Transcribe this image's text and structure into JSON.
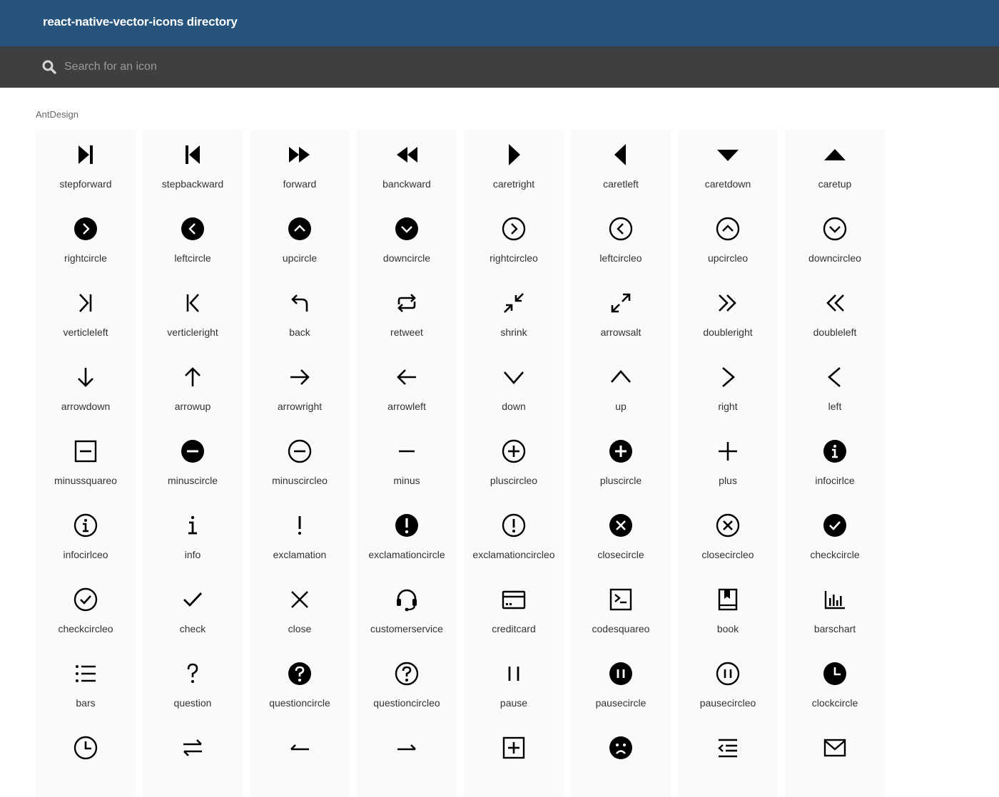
{
  "app": {
    "title": "react-native-vector-icons directory"
  },
  "search": {
    "placeholder": "Search for an icon",
    "value": ""
  },
  "colors": {
    "header": "#26547c",
    "search_bar": "#3f3f3f",
    "tile": "#fafafa"
  },
  "section": {
    "label": "AntDesign",
    "icons": [
      {
        "label": "stepforward",
        "icon": "stepforward"
      },
      {
        "label": "stepbackward",
        "icon": "stepbackward"
      },
      {
        "label": "forward",
        "icon": "forward"
      },
      {
        "label": "banckward",
        "icon": "backward"
      },
      {
        "label": "caretright",
        "icon": "caretright"
      },
      {
        "label": "caretleft",
        "icon": "caretleft"
      },
      {
        "label": "caretdown",
        "icon": "caretdown"
      },
      {
        "label": "caretup",
        "icon": "caretup"
      },
      {
        "label": "rightcircle",
        "icon": "rightcircle"
      },
      {
        "label": "leftcircle",
        "icon": "leftcircle"
      },
      {
        "label": "upcircle",
        "icon": "upcircle"
      },
      {
        "label": "downcircle",
        "icon": "downcircle"
      },
      {
        "label": "rightcircleo",
        "icon": "rightcircleo"
      },
      {
        "label": "leftcircleo",
        "icon": "leftcircleo"
      },
      {
        "label": "upcircleo",
        "icon": "upcircleo"
      },
      {
        "label": "downcircleo",
        "icon": "downcircleo"
      },
      {
        "label": "verticleleft",
        "icon": "verticleleft"
      },
      {
        "label": "verticleright",
        "icon": "verticleright"
      },
      {
        "label": "back",
        "icon": "back"
      },
      {
        "label": "retweet",
        "icon": "retweet"
      },
      {
        "label": "shrink",
        "icon": "shrink"
      },
      {
        "label": "arrowsalt",
        "icon": "arrowsalt"
      },
      {
        "label": "doubleright",
        "icon": "doubleright"
      },
      {
        "label": "doubleleft",
        "icon": "doubleleft"
      },
      {
        "label": "arrowdown",
        "icon": "arrowdown"
      },
      {
        "label": "arrowup",
        "icon": "arrowup"
      },
      {
        "label": "arrowright",
        "icon": "arrowright"
      },
      {
        "label": "arrowleft",
        "icon": "arrowleft"
      },
      {
        "label": "down",
        "icon": "down"
      },
      {
        "label": "up",
        "icon": "up"
      },
      {
        "label": "right",
        "icon": "right"
      },
      {
        "label": "left",
        "icon": "left"
      },
      {
        "label": "minussquareo",
        "icon": "minussquareo"
      },
      {
        "label": "minuscircle",
        "icon": "minuscircle"
      },
      {
        "label": "minuscircleo",
        "icon": "minuscircleo"
      },
      {
        "label": "minus",
        "icon": "minus"
      },
      {
        "label": "pluscircleo",
        "icon": "pluscircleo"
      },
      {
        "label": "pluscircle",
        "icon": "pluscircle"
      },
      {
        "label": "plus",
        "icon": "plus"
      },
      {
        "label": "infocirlce",
        "icon": "infocircle"
      },
      {
        "label": "infocirlceo",
        "icon": "infocircleo"
      },
      {
        "label": "info",
        "icon": "info"
      },
      {
        "label": "exclamation",
        "icon": "exclamation"
      },
      {
        "label": "exclamationcircle",
        "icon": "exclamationcircle"
      },
      {
        "label": "exclamationcircleo",
        "icon": "exclamationcircleo"
      },
      {
        "label": "closecircle",
        "icon": "closecircle"
      },
      {
        "label": "closecircleo",
        "icon": "closecircleo"
      },
      {
        "label": "checkcircle",
        "icon": "checkcircle"
      },
      {
        "label": "checkcircleo",
        "icon": "checkcircleo"
      },
      {
        "label": "check",
        "icon": "check"
      },
      {
        "label": "close",
        "icon": "close"
      },
      {
        "label": "customerservice",
        "icon": "customerservice"
      },
      {
        "label": "creditcard",
        "icon": "creditcard"
      },
      {
        "label": "codesquareo",
        "icon": "codesquareo"
      },
      {
        "label": "book",
        "icon": "book"
      },
      {
        "label": "barschart",
        "icon": "barschart"
      },
      {
        "label": "bars",
        "icon": "bars"
      },
      {
        "label": "question",
        "icon": "question"
      },
      {
        "label": "questioncircle",
        "icon": "questioncircle"
      },
      {
        "label": "questioncircleo",
        "icon": "questioncircleo"
      },
      {
        "label": "pause",
        "icon": "pause"
      },
      {
        "label": "pausecircle",
        "icon": "pausecircle"
      },
      {
        "label": "pausecircleo",
        "icon": "pausecircleo"
      },
      {
        "label": "clockcircle",
        "icon": "clockcircle"
      },
      {
        "label": "",
        "icon": "clockcircleo"
      },
      {
        "label": "",
        "icon": "swap"
      },
      {
        "label": "",
        "icon": "swapleft"
      },
      {
        "label": "",
        "icon": "swapright"
      },
      {
        "label": "",
        "icon": "plussquareo"
      },
      {
        "label": "",
        "icon": "frown"
      },
      {
        "label": "",
        "icon": "menufold"
      },
      {
        "label": "",
        "icon": "mail"
      }
    ]
  }
}
